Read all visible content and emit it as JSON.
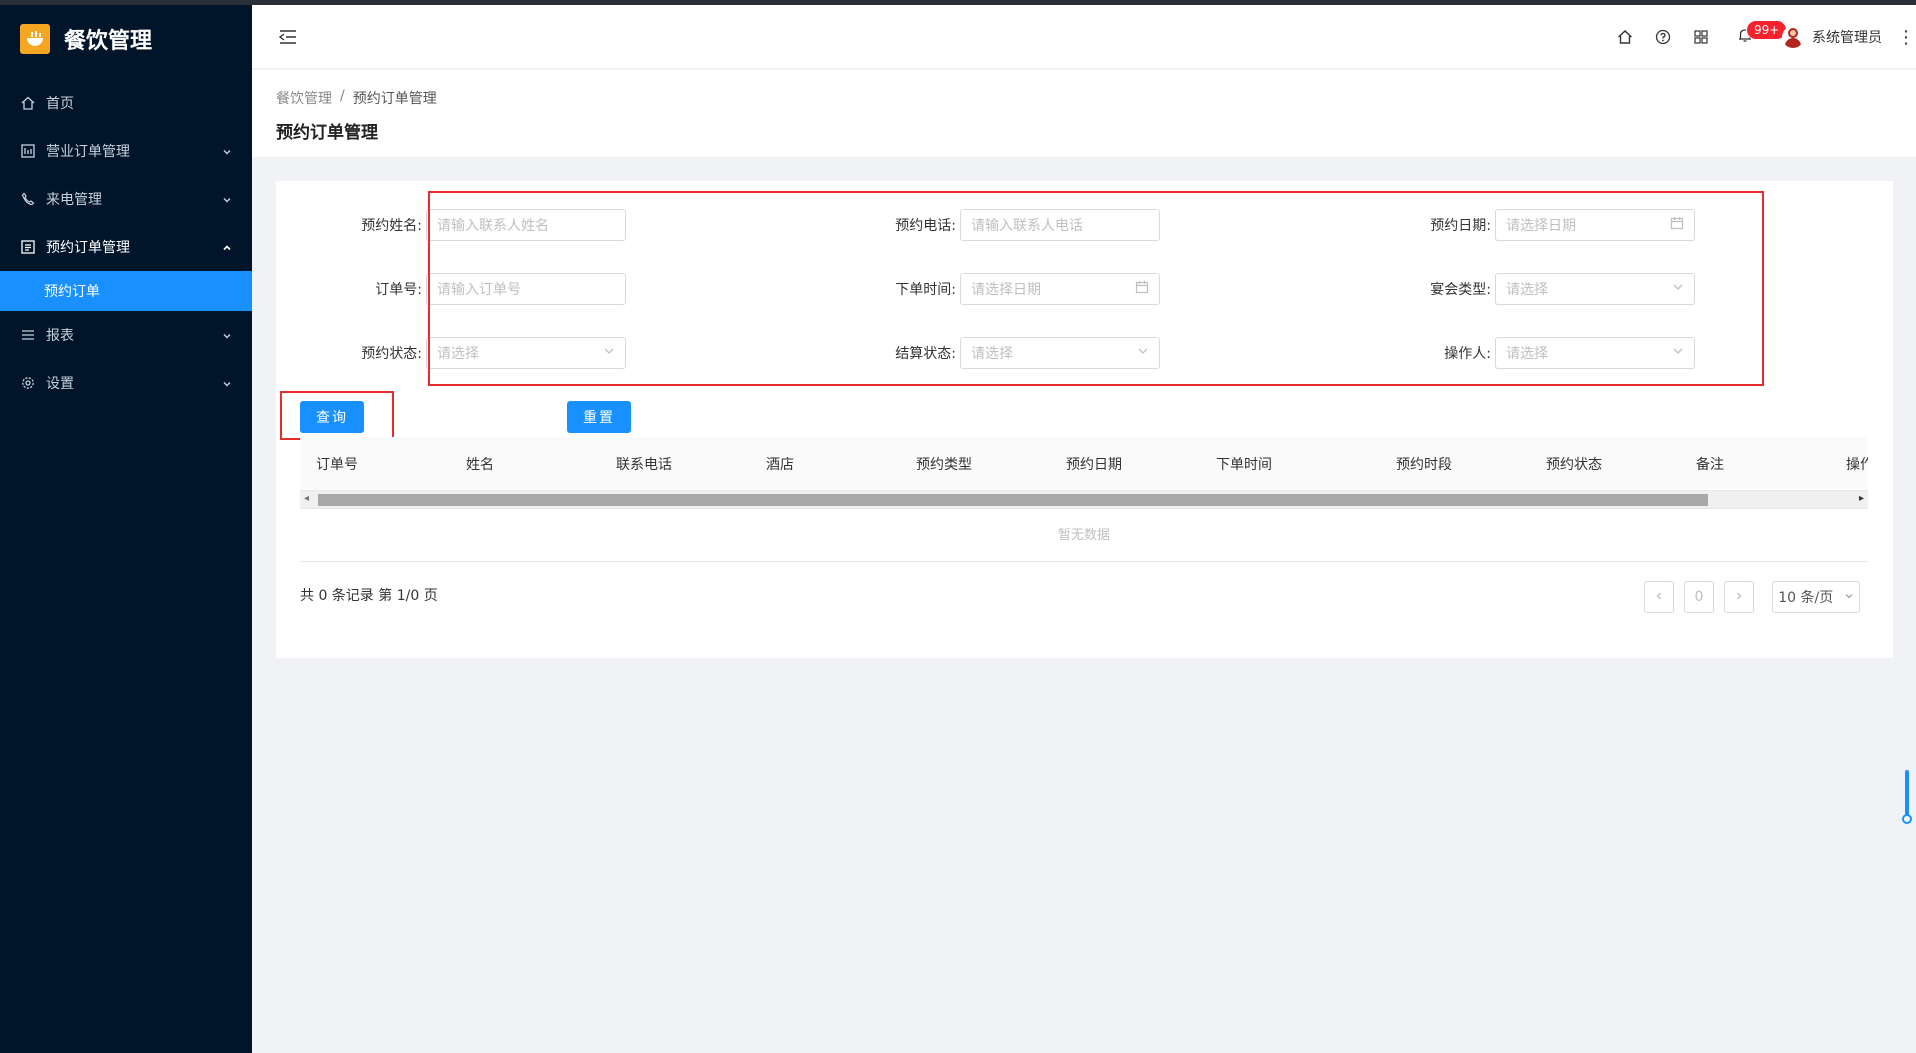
{
  "app": {
    "title": "餐饮管理"
  },
  "sidebar": {
    "items": [
      {
        "label": "首页",
        "icon": "home-icon"
      },
      {
        "label": "营业订单管理",
        "icon": "table-icon"
      },
      {
        "label": "来电管理",
        "icon": "phone-icon"
      },
      {
        "label": "预约订单管理",
        "icon": "list-icon"
      },
      {
        "label": "预约订单",
        "icon": ""
      },
      {
        "label": "报表",
        "icon": "menu-lines-icon"
      },
      {
        "label": "设置",
        "icon": "gear-icon"
      }
    ]
  },
  "header": {
    "badge": "99+",
    "user_name": "系统管理员"
  },
  "breadcrumb": {
    "root": "餐饮管理",
    "sep": "/",
    "current": "预约订单管理"
  },
  "page_title": "预约订单管理",
  "form": {
    "name_label": "预约姓名:",
    "name_ph": "请输入联系人姓名",
    "phone_label": "预约电话:",
    "phone_ph": "请输入联系人电话",
    "date_label": "预约日期:",
    "date_ph": "请选择日期",
    "order_label": "订单号:",
    "order_ph": "请输入订单号",
    "order_time_label": "下单时间:",
    "order_time_ph": "请选择日期",
    "banquet_label": "宴会类型:",
    "banquet_ph": "请选择",
    "status_label": "预约状态:",
    "status_ph": "请选择",
    "settle_label": "结算状态:",
    "settle_ph": "请选择",
    "operator_label": "操作人:",
    "operator_ph": "请选择"
  },
  "buttons": {
    "query": "查询",
    "reset": "重置"
  },
  "table": {
    "columns": [
      "订单号",
      "姓名",
      "联系电话",
      "酒店",
      "预约类型",
      "预约日期",
      "下单时间",
      "预约时段",
      "预约状态",
      "备注",
      "操作"
    ],
    "empty": "暂无数据"
  },
  "pagination": {
    "total": "共 0 条记录 第 1/0 页",
    "page": "0",
    "size": "10 条/页"
  },
  "colors": {
    "primary": "#1890ff",
    "sidebar_bg": "#001529",
    "highlight": "#e62e2e",
    "logo": "#f5a623"
  }
}
